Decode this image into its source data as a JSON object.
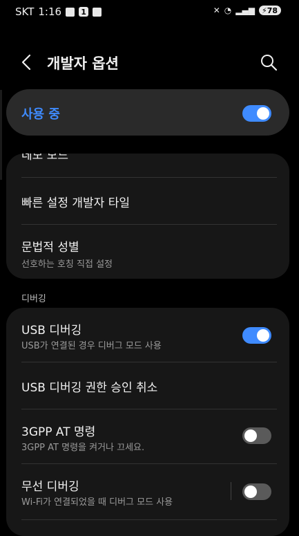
{
  "status_bar": {
    "carrier": "SKT",
    "time": "1:16",
    "notif_count": "1",
    "battery": "78"
  },
  "app_bar": {
    "title": "개발자 옵션"
  },
  "master_switch": {
    "label": "사용 중",
    "enabled": true
  },
  "card1": {
    "partial_label": "데모 모드",
    "items": [
      {
        "title": "빠른 설정 개발자 타일"
      },
      {
        "title": "문법적 성별",
        "subtitle": "선호하는 호칭 직접 설정"
      }
    ]
  },
  "section_debug": {
    "label": "디버깅"
  },
  "card2": {
    "items": [
      {
        "title": "USB 디버깅",
        "subtitle": "USB가 연결된 경우 디버그 모드 사용",
        "toggle": true
      },
      {
        "title": "USB 디버깅 권한 승인 취소"
      },
      {
        "title": "3GPP AT 명령",
        "subtitle": "3GPP AT 명령을 켜거나 끄세요.",
        "toggle": false
      },
      {
        "title": "무선 디버깅",
        "subtitle": "Wi-Fi가 연결되었을 때 디버그 모드 사용",
        "toggle": false
      }
    ]
  },
  "colors": {
    "accent": "#3f8bff",
    "background": "#000000",
    "card": "#171717"
  }
}
